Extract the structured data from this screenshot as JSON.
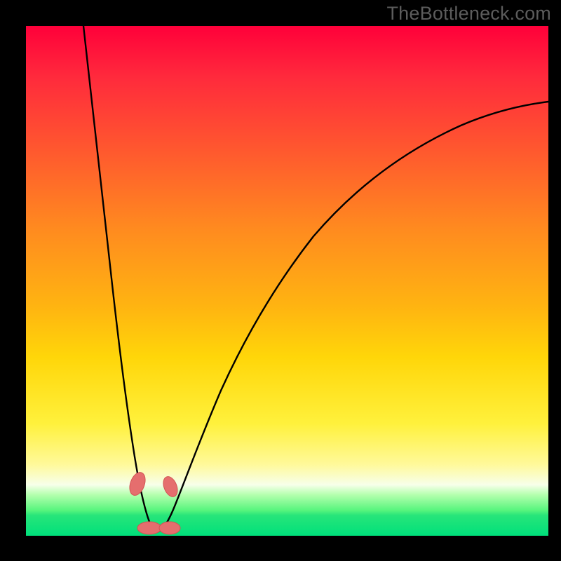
{
  "watermark": "TheBottleneck.com",
  "chart_data": {
    "type": "line",
    "title": "",
    "xlabel": "",
    "ylabel": "",
    "xlim": [
      0,
      100
    ],
    "ylim": [
      0,
      100
    ],
    "grid": false,
    "legend": false,
    "notes": "Unlabeled bottleneck curve over red-yellow-green gradient. Y encodes bottleneck severity (top=red/high, bottom=green/low). X is an unlabeled parameter. Two curve branches meet at a minimum near x≈24 where bottleneck ≈0. Values are visual estimates; no numeric axes are rendered.",
    "series": [
      {
        "name": "left-branch",
        "x": [
          11,
          13,
          15,
          17,
          19,
          20,
          21,
          22,
          23,
          24
        ],
        "y": [
          100,
          82,
          64,
          46,
          28,
          19,
          13,
          8,
          4,
          1
        ]
      },
      {
        "name": "right-branch",
        "x": [
          24,
          26,
          28,
          30,
          33,
          37,
          42,
          50,
          60,
          72,
          85,
          100
        ],
        "y": [
          1,
          6,
          13,
          20,
          29,
          39,
          49,
          60,
          68,
          75,
          80,
          84
        ]
      }
    ],
    "annotations": [
      {
        "name": "blob-left-upper",
        "x": 22.0,
        "y": 9.0
      },
      {
        "name": "blob-right-upper",
        "x": 27.2,
        "y": 9.5
      },
      {
        "name": "blob-bottom-left",
        "x": 23.5,
        "y": 2.0
      },
      {
        "name": "blob-bottom-right",
        "x": 27.5,
        "y": 2.0
      }
    ],
    "colors": {
      "curve": "#000000",
      "blob_fill": "#e56e6e",
      "gradient_top": "#ff003a",
      "gradient_mid": "#ffd609",
      "gradient_bottom": "#00e07b"
    }
  }
}
